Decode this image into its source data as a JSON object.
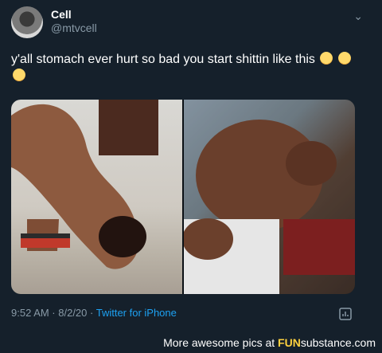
{
  "tweet": {
    "display_name": "Cell",
    "handle": "@mtvcell",
    "text": "y'all stomach ever hurt so bad you start shittin like this",
    "emoji_icon": "loudly-crying-face-emoji",
    "timestamp": "9:52 AM · 8/2/20 · ",
    "source": "Twitter for iPhone"
  },
  "icons": {
    "chevron": "chevron-down-icon",
    "analytics": "analytics-icon"
  },
  "watermark": {
    "prefix": "More awesome pics at ",
    "brand_a": "FUN",
    "brand_b": "substance",
    "suffix": ".com"
  },
  "colors": {
    "background": "#15202b",
    "secondary_text": "#8899a6",
    "link": "#1da1f2"
  }
}
